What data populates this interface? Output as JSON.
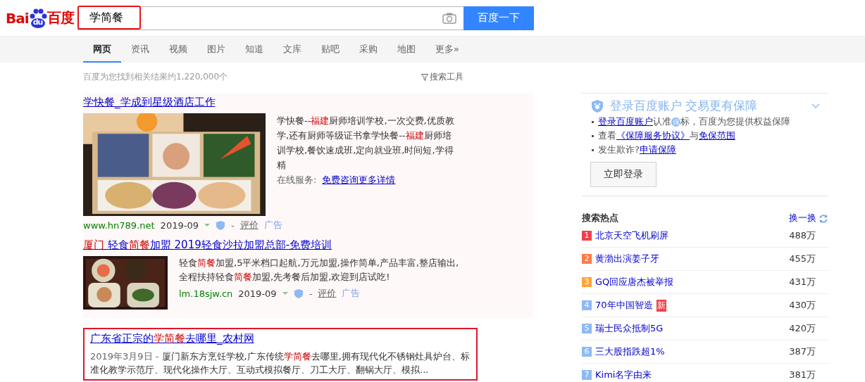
{
  "logo": {
    "left": "Bai",
    "paw": "du",
    "right": "百度"
  },
  "search": {
    "value": "学简餐",
    "highlighted": true,
    "button": "百度一下"
  },
  "tabs": [
    {
      "label": "网页",
      "selected": true
    },
    {
      "label": "资讯",
      "selected": false
    },
    {
      "label": "视频",
      "selected": false
    },
    {
      "label": "图片",
      "selected": false
    },
    {
      "label": "知道",
      "selected": false
    },
    {
      "label": "文库",
      "selected": false
    },
    {
      "label": "贴吧",
      "selected": false
    },
    {
      "label": "采购",
      "selected": false
    },
    {
      "label": "地图",
      "selected": false
    },
    {
      "label": "更多»",
      "selected": false
    }
  ],
  "result_count": "百度为您找到相关结果约1,220,000个",
  "search_tools": "搜索工具",
  "results": [
    {
      "kind": "ad_large",
      "title": [
        {
          "kind": "plain",
          "text": "学快餐_学成到星级酒店工作"
        }
      ],
      "snippet": [
        {
          "kind": "plain",
          "text": "学快餐--"
        },
        {
          "kind": "match",
          "text": "福建"
        },
        {
          "kind": "plain",
          "text": "厨师培训学校,一次交费,优质教学,还有厨师等级证书拿学快餐--"
        },
        {
          "kind": "match",
          "text": "福建"
        },
        {
          "kind": "plain",
          "text": "厨师培训学校,餐饮速成班,定向就业班,时间短,学得精"
        }
      ],
      "service_label": "在线服务:",
      "service_link": "免费咨询更多详情",
      "url": "www.hn789.net",
      "date": "2019-09",
      "sep": "-",
      "rate": "评价",
      "ad": "广告",
      "boxed": false
    },
    {
      "kind": "ad_small",
      "title": [
        {
          "kind": "match",
          "text": "厦门"
        },
        {
          "kind": "plain",
          "text": " 轻食"
        },
        {
          "kind": "match",
          "text": "简餐"
        },
        {
          "kind": "plain",
          "text": "加盟 2019轻食沙拉加盟总部-免费培训"
        }
      ],
      "snippet": [
        {
          "kind": "plain",
          "text": "轻食"
        },
        {
          "kind": "match",
          "text": "简餐"
        },
        {
          "kind": "plain",
          "text": "加盟,5平米档口起航,万元加盟,操作简单,产品丰富,整店输出,全程扶持轻食"
        },
        {
          "kind": "match",
          "text": "简餐"
        },
        {
          "kind": "plain",
          "text": "加盟,先考餐后加盟,欢迎到店试吃!"
        }
      ],
      "url": "lm.18sjw.cn",
      "date": "2019-09",
      "sep": "-",
      "rate": "评价",
      "ad": "广告",
      "boxed": false
    },
    {
      "kind": "organic",
      "title": [
        {
          "kind": "plain",
          "text": "广东省正宗的"
        },
        {
          "kind": "match",
          "text": "学简餐"
        },
        {
          "kind": "plain",
          "text": "去哪里_农村网"
        }
      ],
      "date": "2019年3月9日",
      "sep": "-",
      "snippet": [
        {
          "kind": "plain",
          "text": "厦门新东方烹饪学校,广东传统"
        },
        {
          "kind": "match",
          "text": "学简餐"
        },
        {
          "kind": "plain",
          "text": "去哪里,拥有现代化不锈钢灶具炉台、标准化教学示范厅、现代化操作大厅、互动式模拟餐厅、刀工大厅、翻锅大厅、模拟..."
        }
      ],
      "boxed": true
    }
  ],
  "login_panel": {
    "title": "登录百度账户 交易更有保障",
    "lines": [
      [
        {
          "kind": "link",
          "text": "登录百度账户"
        },
        {
          "kind": "text",
          "text": "认准"
        },
        {
          "kind": "badge",
          "text": "保"
        },
        {
          "kind": "text",
          "text": "标，百度为您提供权益保障"
        }
      ],
      [
        {
          "kind": "text",
          "text": "查看"
        },
        {
          "kind": "link",
          "text": "《保障服务协议》"
        },
        {
          "kind": "text",
          "text": "与"
        },
        {
          "kind": "link",
          "text": "免保范围"
        }
      ],
      [
        {
          "kind": "text",
          "text": "发生欺诈?"
        },
        {
          "kind": "link",
          "text": "申请保障"
        }
      ]
    ],
    "button": "立即登录"
  },
  "hot": {
    "title": "搜索热点",
    "refresh": "换一换",
    "items": [
      {
        "rank": "1",
        "title": "北京天空飞机刷屏",
        "count": "488万",
        "color": "#f1404b"
      },
      {
        "rank": "2",
        "title": "黄渤出演姜子牙",
        "count": "455万",
        "color": "#ff7a45"
      },
      {
        "rank": "3",
        "title": "GQ回应唐杰被举报",
        "count": "431万",
        "color": "#ffa33a"
      },
      {
        "rank": "4",
        "title": "70年中国智造",
        "badge": "新",
        "count": "430万",
        "color": "#8eb9f5"
      },
      {
        "rank": "5",
        "title": "瑞士民众抵制5G",
        "count": "420万",
        "color": "#8eb9f5"
      },
      {
        "rank": "6",
        "title": "三大股指跌超1%",
        "count": "387万",
        "color": "#8eb9f5"
      },
      {
        "rank": "7",
        "title": "Kimi名字由来",
        "count": "381万",
        "color": "#8eb9f5"
      }
    ]
  }
}
